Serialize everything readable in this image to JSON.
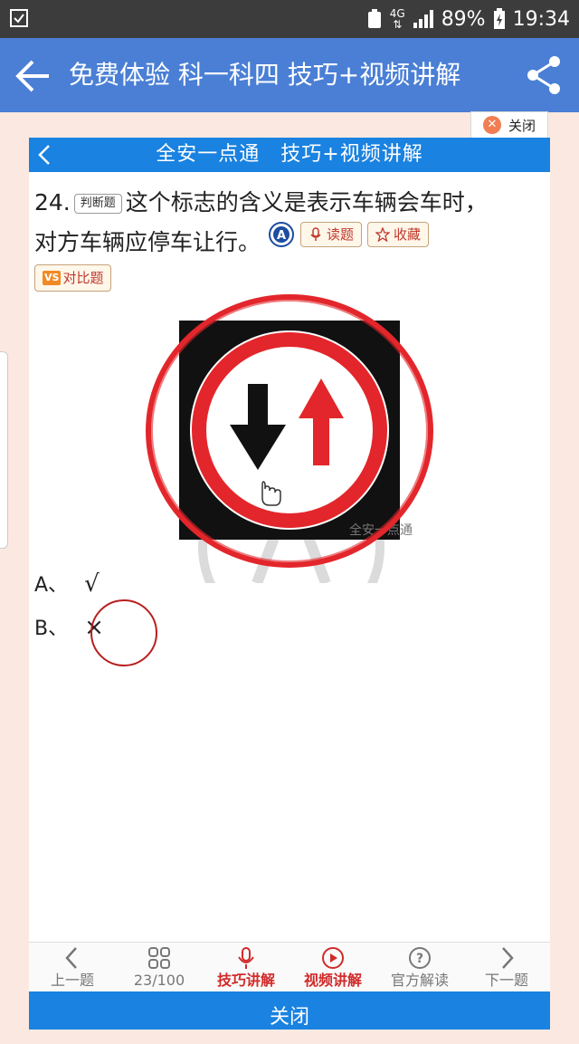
{
  "status_bar": {
    "network": "4G",
    "battery": "89%",
    "time": "19:34",
    "left_icon": "checkbox-icon"
  },
  "app_bar": {
    "title": "免费体验 科一科四 技巧+视频讲解"
  },
  "close_tag": {
    "label": "关闭"
  },
  "panel": {
    "header_title": "全安一点通　技巧+视频讲解"
  },
  "question": {
    "number": "24.",
    "type": "判断题",
    "text_line1": "这个标志的含义是表示车辆会车时，",
    "text_line2": "对方车辆应停车让行。",
    "read_label": "读题",
    "fav_label": "收藏",
    "vs_label": "VS",
    "compare_label": "对比题",
    "watermark": "全安一点通"
  },
  "options": [
    {
      "letter": "A、",
      "mark": "√"
    },
    {
      "letter": "B、",
      "mark": "×"
    }
  ],
  "bottom_nav": [
    {
      "label": "上一题",
      "icon": "chevron-left-icon",
      "active": false
    },
    {
      "label": "23/100",
      "icon": "grid-icon",
      "active": false
    },
    {
      "label": "技巧讲解",
      "icon": "microphone-icon",
      "active": true
    },
    {
      "label": "视频讲解",
      "icon": "play-icon",
      "active": true
    },
    {
      "label": "官方解读",
      "icon": "question-icon",
      "active": false
    },
    {
      "label": "下一题",
      "icon": "chevron-right-icon",
      "active": false
    }
  ],
  "close_button": {
    "label": "关闭"
  },
  "colors": {
    "app_bar": "#4a7fd5",
    "panel_header": "#1a82e0",
    "sign_red": "#e3262b",
    "answer_circle": "#b81f1f"
  }
}
